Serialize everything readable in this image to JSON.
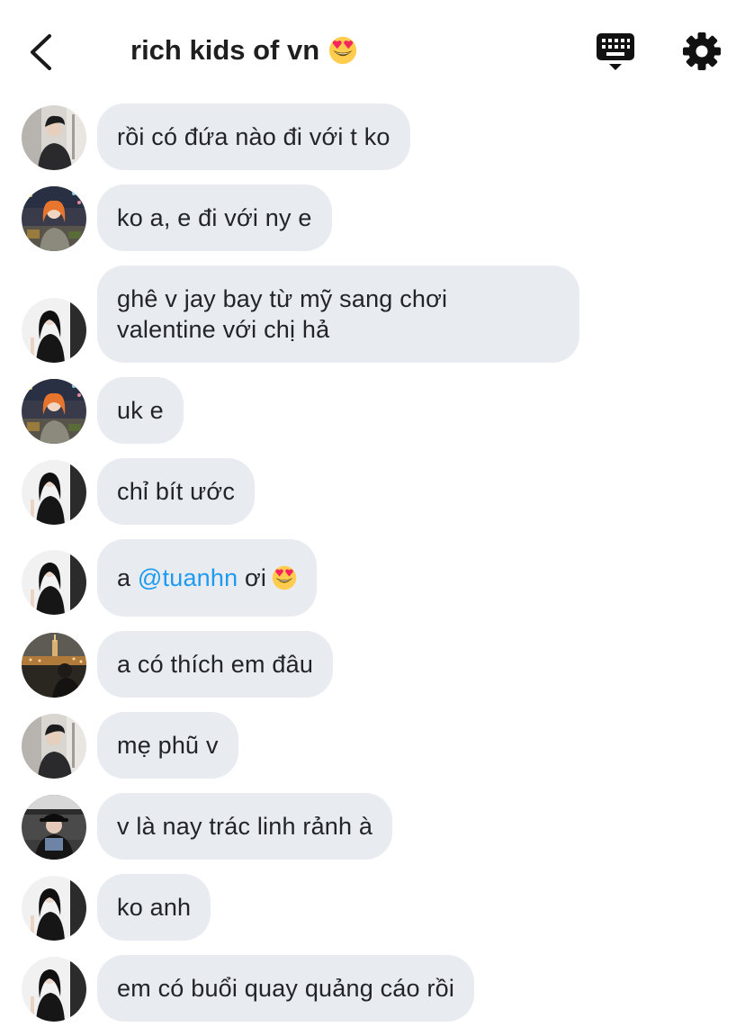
{
  "header": {
    "title": "rich kids of vn",
    "title_emoji": "heart-eyes-emoji",
    "back_icon": "chevron-left-icon",
    "keyboard_icon": "keyboard-hide-icon",
    "settings_icon": "gear-icon"
  },
  "colors": {
    "bubble_bg": "#e8ebf0",
    "mention": "#1d9bf0",
    "text": "#222428"
  },
  "messages": [
    {
      "avatar": "avatar-boy-dark-hair",
      "text": "rồi có đứa nào đi với t ko"
    },
    {
      "avatar": "avatar-girl-orange-hair",
      "text": "ko a, e đi với ny e"
    },
    {
      "avatar": "avatar-girl-black-dress",
      "line1": "ghê v jay bay từ mỹ sang chơi",
      "line2": "valentine với chị hả"
    },
    {
      "avatar": "avatar-girl-orange-hair",
      "text": "uk e"
    },
    {
      "avatar": "avatar-girl-black-dress",
      "text": "chỉ bít ước"
    },
    {
      "avatar": "avatar-girl-black-dress",
      "prefix": "a",
      "mention": "@tuanhn",
      "suffix": "ơi"
    },
    {
      "avatar": "avatar-night-city",
      "text": "a có thích em đâu"
    },
    {
      "avatar": "avatar-boy-dark-hair",
      "text": "mẹ phũ v"
    },
    {
      "avatar": "avatar-boy-hat",
      "text": "v là nay trác linh rảnh à"
    },
    {
      "avatar": "avatar-girl-black-dress",
      "text": "ko anh"
    },
    {
      "avatar": "avatar-girl-black-dress",
      "text": "em có buổi quay quảng cáo rồi"
    }
  ]
}
